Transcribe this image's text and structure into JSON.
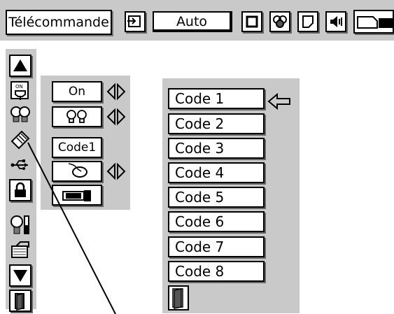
{
  "header": {
    "title": "Télécommande",
    "mode_value": "Auto",
    "icons": [
      "input-icon",
      "screen-icon",
      "color-icon",
      "image-icon",
      "sound-icon",
      "projector-icon"
    ]
  },
  "sidebar": {
    "icons": [
      "up-arrow-icon",
      "power-plug-icon",
      "lamp-icon",
      "remote-control-icon",
      "usb-icon",
      "lock-icon",
      "lamp-reset-icon",
      "filter-icon",
      "down-arrow-icon",
      "exit-door-icon"
    ]
  },
  "settings": {
    "power_value": "On",
    "remote_value": "Code1"
  },
  "code_list": {
    "items": [
      "Code 1",
      "Code 2",
      "Code 3",
      "Code 4",
      "Code 5",
      "Code 6",
      "Code 7",
      "Code 8"
    ],
    "selected_index": 0
  }
}
